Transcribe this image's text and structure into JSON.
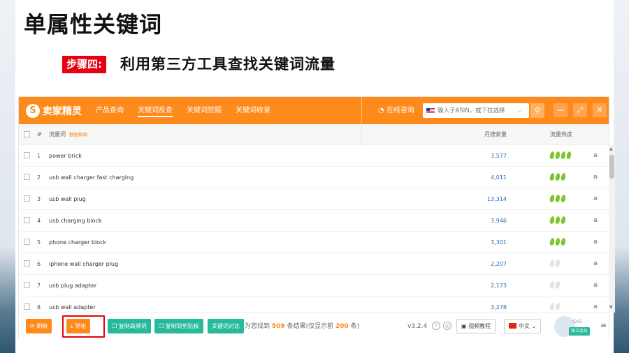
{
  "slide": {
    "title": "单属性关键词",
    "step_tag": "步骤四:",
    "step_text": "利用第三方工具查找关键词流量"
  },
  "app": {
    "logo_text": "卖家精灵",
    "nav": [
      {
        "label": "产品查询",
        "active": false
      },
      {
        "label": "关键词反查",
        "active": true
      },
      {
        "label": "关键词挖掘",
        "active": false
      },
      {
        "label": "关键词收录",
        "active": false
      }
    ],
    "consult_label": "在线咨询",
    "search_placeholder": "输入子ASIN，或下拉选择",
    "table": {
      "col_index": "#",
      "col_keyword": "流量词",
      "col_keyword_sub": "数据解释",
      "col_volume": "月搜索量",
      "col_heat": "流量热度",
      "rows": [
        {
          "idx": "1",
          "keyword": "power brick",
          "volume": "3,577",
          "heat": 4
        },
        {
          "idx": "2",
          "keyword": "usb wall charger fast charging",
          "volume": "4,011",
          "heat": 3
        },
        {
          "idx": "3",
          "keyword": "usb wall plug",
          "volume": "13,314",
          "heat": 3
        },
        {
          "idx": "4",
          "keyword": "usb charging block",
          "volume": "3,946",
          "heat": 3
        },
        {
          "idx": "5",
          "keyword": "phone charger block",
          "volume": "3,301",
          "heat": 3
        },
        {
          "idx": "6",
          "keyword": "iphone wall charger plug",
          "volume": "2,207",
          "heat": 0
        },
        {
          "idx": "7",
          "keyword": "usb plug adapter",
          "volume": "2,173",
          "heat": 0
        },
        {
          "idx": "8",
          "keyword": "usb wall adapter",
          "volume": "3,278",
          "heat": 0
        }
      ]
    },
    "footer": {
      "refresh": "刷新",
      "export": "导出",
      "copy_high": "复制高频词",
      "copy_clipboard": "复制到剪贴板",
      "compare": "关键词对比",
      "result_prefix": "为您找到",
      "result_count": "509",
      "result_mid": "条结果(仅显示前",
      "result_shown": "200",
      "result_suffix": "条)",
      "version": "v3.2.4",
      "video": "视频教程",
      "lang": "中文",
      "user_name": "心心",
      "member_badge": "独立会员"
    }
  }
}
